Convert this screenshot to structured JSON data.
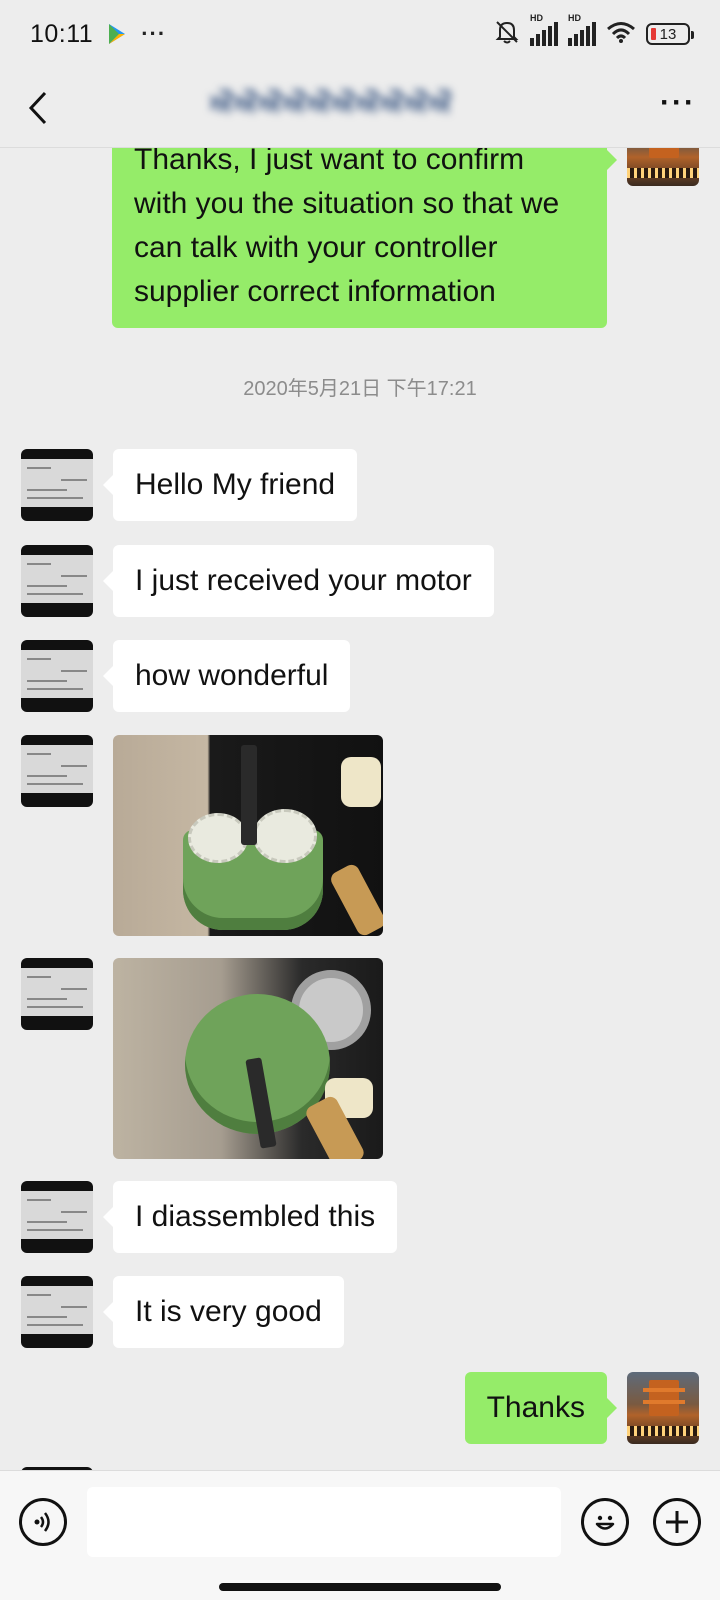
{
  "status_bar": {
    "time": "10:11",
    "extra": "···",
    "network_1": "HD",
    "network_2": "HD",
    "battery": "13",
    "icons": [
      "play-store-icon",
      "mute-bell-icon",
      "signal-icon",
      "wifi-icon",
      "battery-icon"
    ]
  },
  "header": {
    "title": "ਔਔਔਔਔਔਔਔਔਔ",
    "back_icon": "chevron-left-icon",
    "more_label": "···"
  },
  "messages": {
    "m1": {
      "side": "out",
      "text": "Thanks, I just want to confirm with you the situation so that we can talk with your controller supplier correct information"
    },
    "timestamp": "2020年5月21日 下午17:21",
    "m2": {
      "side": "in",
      "text": "Hello My friend"
    },
    "m3": {
      "side": "in",
      "text": "I just received your motor"
    },
    "m4": {
      "side": "in",
      "text": "how wonderful"
    },
    "m5": {
      "side": "in",
      "type": "image",
      "content": "photo"
    },
    "m6": {
      "side": "in",
      "type": "image",
      "content": "photo"
    },
    "m7": {
      "side": "in",
      "text": "I diassembled this"
    },
    "m8": {
      "side": "in",
      "text": "It is very good"
    },
    "m9": {
      "side": "out",
      "text": "Thanks"
    }
  },
  "input_bar": {
    "value": "",
    "icons": [
      "voice-icon",
      "emoji-icon",
      "plus-icon"
    ]
  },
  "colors": {
    "background": "#ededed",
    "outgoing_bubble": "#95ec69",
    "incoming_bubble": "#ffffff",
    "timestamp": "#8c8c8c",
    "battery_low": "#e53935"
  }
}
